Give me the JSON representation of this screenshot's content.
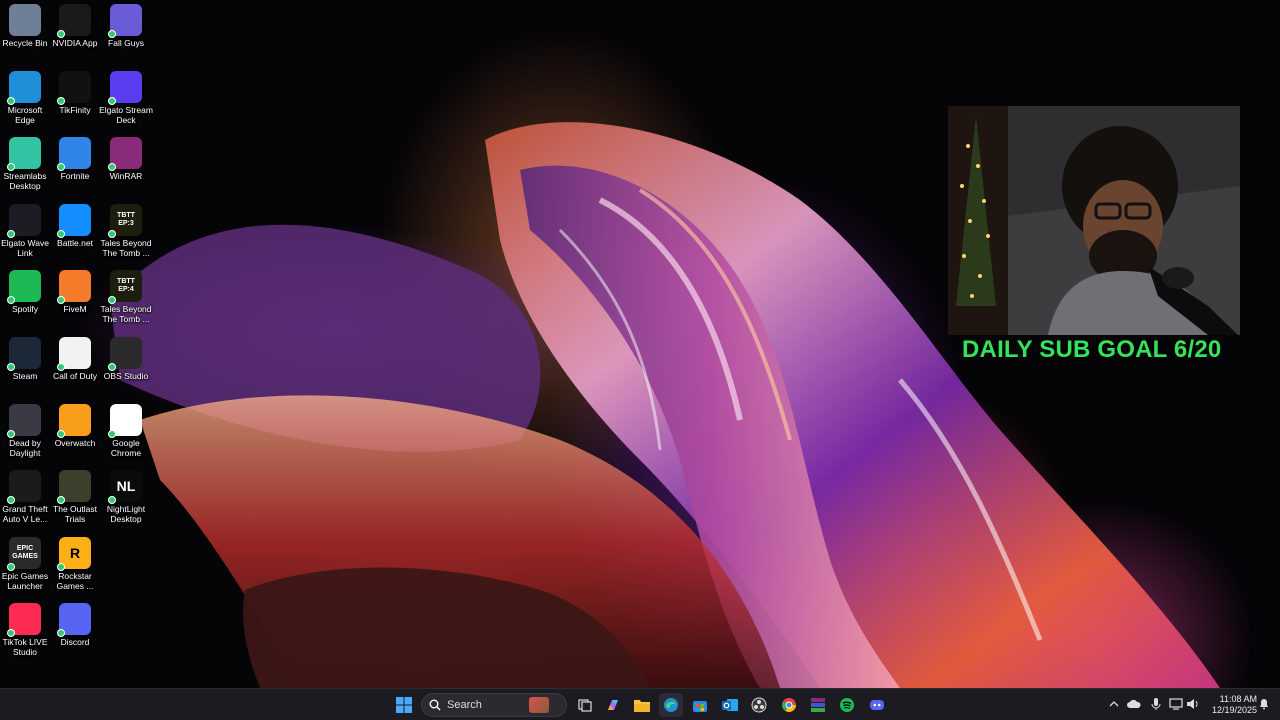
{
  "desktop": {
    "icons": [
      {
        "label": "Recycle Bin",
        "icon": "recycle-bin-icon",
        "color": "#6f7f95"
      },
      {
        "label": "NVIDIA App",
        "icon": "nvidia-icon",
        "color": "#1a1a1a"
      },
      {
        "label": "Fall Guys",
        "icon": "fall-guys-icon",
        "color": "#6a5bd6"
      },
      {
        "label": "Microsoft Edge",
        "icon": "edge-icon",
        "color": "#1f8fd8"
      },
      {
        "label": "TikFinity",
        "icon": "tikfinity-icon",
        "color": "#111111"
      },
      {
        "label": "Elgato Stream Deck",
        "icon": "stream-deck-icon",
        "color": "#5a3df0"
      },
      {
        "label": "Streamlabs Desktop",
        "icon": "streamlabs-icon",
        "color": "#31c3a2"
      },
      {
        "label": "Fortnite",
        "icon": "fortnite-icon",
        "color": "#2f86e8"
      },
      {
        "label": "WinRAR",
        "icon": "winrar-icon",
        "color": "#8a2a7a"
      },
      {
        "label": "Elgato Wave Link",
        "icon": "wave-link-icon",
        "color": "#1c1c24"
      },
      {
        "label": "Battle.net",
        "icon": "battlenet-icon",
        "color": "#148eff"
      },
      {
        "label": "Tales Beyond The Tomb ...",
        "icon": "tbtt-ep3-icon",
        "color": "#1d1d10",
        "tile_text": "TBTT EP:3"
      },
      {
        "label": "Spotify",
        "icon": "spotify-icon",
        "color": "#1db954"
      },
      {
        "label": "FiveM",
        "icon": "fivem-icon",
        "color": "#f47b2a"
      },
      {
        "label": "Tales Beyond The Tomb ...",
        "icon": "tbtt-ep4-icon",
        "color": "#1d1d10",
        "tile_text": "TBTT EP:4"
      },
      {
        "label": "Steam",
        "icon": "steam-icon",
        "color": "#1b2838"
      },
      {
        "label": "Call of Duty",
        "icon": "document-icon",
        "color": "#f2f2f2"
      },
      {
        "label": "OBS Studio",
        "icon": "obs-icon",
        "color": "#2b2b2b"
      },
      {
        "label": "Dead by Daylight",
        "icon": "dead-by-daylight-icon",
        "color": "#3a3a44"
      },
      {
        "label": "Overwatch",
        "icon": "overwatch-icon",
        "color": "#f99e1a"
      },
      {
        "label": "Google Chrome",
        "icon": "chrome-icon",
        "color": "#ffffff"
      },
      {
        "label": "Grand Theft Auto V Le...",
        "icon": "gta-v-icon",
        "color": "#1b1b1b"
      },
      {
        "label": "The Outlast Trials",
        "icon": "outlast-trials-icon",
        "color": "#3e3e2c"
      },
      {
        "label": "NightLight Desktop",
        "icon": "nightlight-icon",
        "color": "#0b0b0b",
        "tile_text": "NL"
      },
      {
        "label": "Epic Games Launcher",
        "icon": "epic-games-icon",
        "color": "#2a2a2a",
        "tile_text": "EPIC GAMES"
      },
      {
        "label": "Rockstar Games ...",
        "icon": "rockstar-icon",
        "color": "#fcaf17",
        "tile_text": "R"
      },
      {
        "label": "TikTok LIVE Studio",
        "icon": "tiktok-live-icon",
        "color": "#fe2c55"
      },
      {
        "label": "Discord",
        "icon": "discord-icon",
        "color": "#5865f2"
      }
    ]
  },
  "stream_overlay": {
    "sub_goal_text": "DAILY SUB GOAL 6/20",
    "sub_goal_color": "#34e35a"
  },
  "taskbar": {
    "search_placeholder": "Search",
    "apps": [
      {
        "icon": "start-windows-icon",
        "color": "#4aa8ff"
      },
      {
        "icon": "search-icon",
        "color": "#ffffff"
      },
      {
        "icon": "widgets-icon",
        "color": "#d9534f"
      },
      {
        "icon": "task-view-icon",
        "color": "#dddddd"
      },
      {
        "icon": "copilot-icon",
        "color": "#a56bf5"
      },
      {
        "icon": "file-explorer-icon",
        "color": "#f5c542"
      },
      {
        "icon": "edge-icon",
        "color": "#1f8fd8"
      },
      {
        "icon": "microsoft-store-icon",
        "color": "#2a8ae2"
      },
      {
        "icon": "outlook-icon",
        "color": "#0f6cbd"
      },
      {
        "icon": "obs-icon",
        "color": "#3a3a3a"
      },
      {
        "icon": "chrome-icon",
        "color": "#e84335"
      },
      {
        "icon": "winrar-icon",
        "color": "#8a2a7a"
      },
      {
        "icon": "spotify-icon",
        "color": "#1db954"
      },
      {
        "icon": "discord-icon",
        "color": "#5865f2"
      }
    ],
    "tray": [
      {
        "icon": "chevron-up-icon"
      },
      {
        "icon": "onedrive-cloud-icon"
      },
      {
        "icon": "microphone-icon"
      },
      {
        "icon": "network-icon"
      },
      {
        "icon": "volume-icon"
      }
    ],
    "clock": {
      "time": "11:08 AM",
      "date": "12/19/2025"
    },
    "notification_icon": "notification-bell-icon"
  }
}
